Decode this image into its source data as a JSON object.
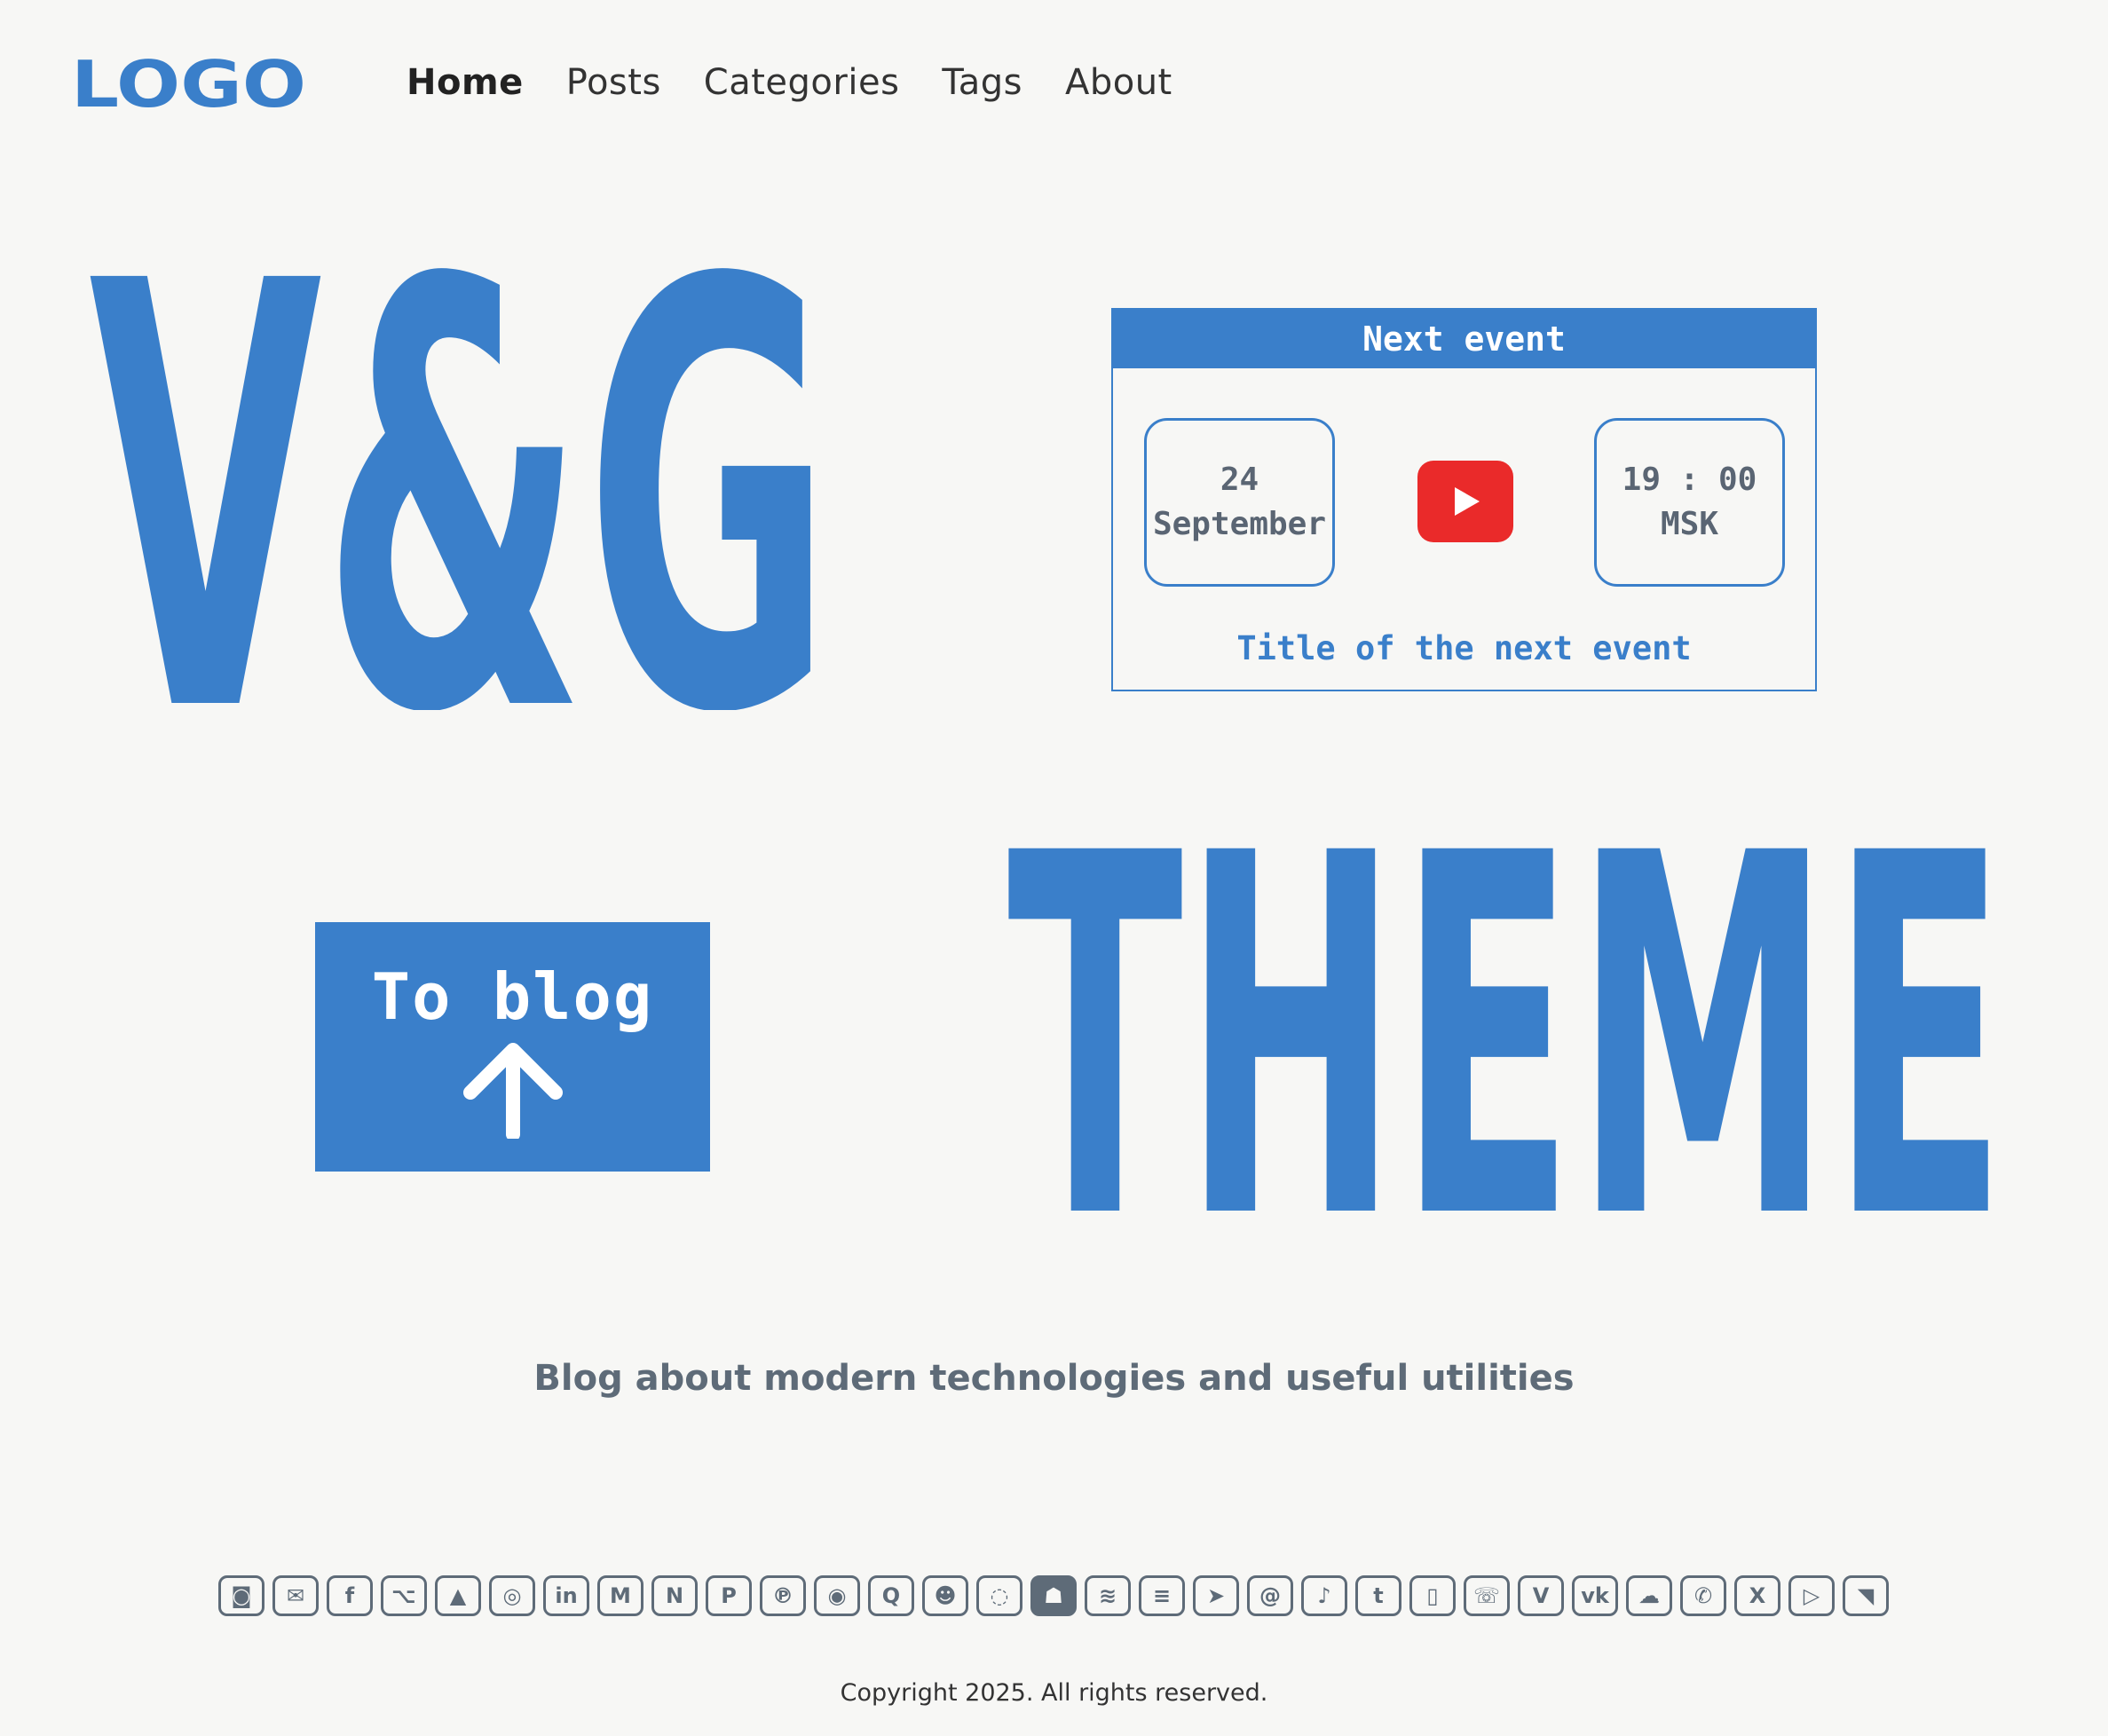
{
  "header": {
    "logo_text": "LOGO",
    "nav": [
      {
        "label": "Home",
        "active": true
      },
      {
        "label": "Posts",
        "active": false
      },
      {
        "label": "Categories",
        "active": false
      },
      {
        "label": "Tags",
        "active": false
      },
      {
        "label": "About",
        "active": false
      }
    ]
  },
  "hero": {
    "vg_text": "V&G",
    "theme_text": "THEME",
    "accent_color": "#3a7fca"
  },
  "event": {
    "heading": "Next event",
    "day": "24",
    "month": "September",
    "time": "19 : 00",
    "timezone": "MSK",
    "title": "Title of the next event",
    "icon": "youtube-icon"
  },
  "cta": {
    "label": "To blog",
    "icon": "arrow-up-icon"
  },
  "tagline": "Blog about modern technologies and useful utilities",
  "social": [
    {
      "name": "discord",
      "glyph": "◙"
    },
    {
      "name": "email",
      "glyph": "✉"
    },
    {
      "name": "facebook",
      "glyph": "f"
    },
    {
      "name": "github",
      "glyph": "⌥"
    },
    {
      "name": "google-drive",
      "glyph": "▲"
    },
    {
      "name": "instagram",
      "glyph": "◎"
    },
    {
      "name": "linkedin",
      "glyph": "in"
    },
    {
      "name": "medium",
      "glyph": "M"
    },
    {
      "name": "notion",
      "glyph": "N"
    },
    {
      "name": "paypal",
      "glyph": "P"
    },
    {
      "name": "pinterest",
      "glyph": "℗"
    },
    {
      "name": "podcasts",
      "glyph": "◉"
    },
    {
      "name": "quora",
      "glyph": "Q"
    },
    {
      "name": "reddit",
      "glyph": "☻"
    },
    {
      "name": "signal",
      "glyph": "◌"
    },
    {
      "name": "snapchat",
      "glyph": "☗"
    },
    {
      "name": "spotify",
      "glyph": "≋"
    },
    {
      "name": "substack",
      "glyph": "≡"
    },
    {
      "name": "telegram",
      "glyph": "➤"
    },
    {
      "name": "threads",
      "glyph": "@"
    },
    {
      "name": "tiktok",
      "glyph": "♪"
    },
    {
      "name": "tumblr",
      "glyph": "t"
    },
    {
      "name": "twitch",
      "glyph": "▯"
    },
    {
      "name": "viber",
      "glyph": "☏"
    },
    {
      "name": "vimeo",
      "glyph": "V"
    },
    {
      "name": "vk",
      "glyph": "vk"
    },
    {
      "name": "wechat",
      "glyph": "☁"
    },
    {
      "name": "whatsapp",
      "glyph": "✆"
    },
    {
      "name": "x",
      "glyph": "X"
    },
    {
      "name": "youtube",
      "glyph": "▷"
    },
    {
      "name": "rss",
      "glyph": "◥"
    }
  ],
  "footer": {
    "copyright": "Copyright 2025. All rights reserved."
  }
}
